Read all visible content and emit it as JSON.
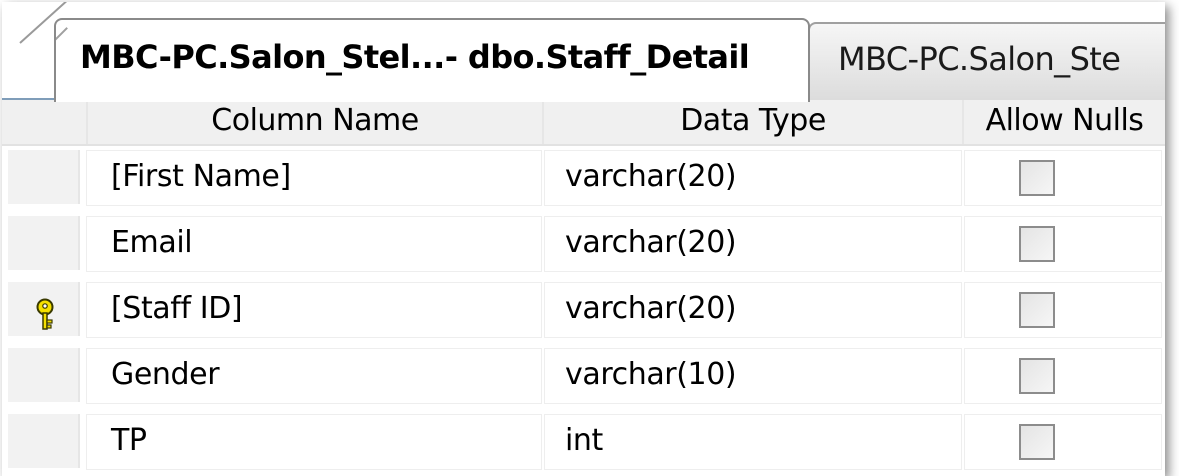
{
  "tabs": [
    {
      "label": "MBC-PC.Salon_Stel...- dbo.Staff_Detail",
      "active": true
    },
    {
      "label": "MBC-PC.Salon_Ste",
      "active": false
    }
  ],
  "columns": {
    "name": "Column Name",
    "type": "Data Type",
    "nulls": "Allow Nulls"
  },
  "rows": [
    {
      "name": "[First Name]",
      "type": "varchar(20)",
      "allow_nulls": false,
      "primary_key": false
    },
    {
      "name": "Email",
      "type": "varchar(20)",
      "allow_nulls": false,
      "primary_key": false
    },
    {
      "name": "[Staff ID]",
      "type": "varchar(20)",
      "allow_nulls": false,
      "primary_key": true,
      "icon": "key-icon"
    },
    {
      "name": "Gender",
      "type": "varchar(10)",
      "allow_nulls": false,
      "primary_key": false
    },
    {
      "name": "TP",
      "type": "int",
      "allow_nulls": false,
      "primary_key": false
    }
  ],
  "colors": {
    "header_bg": "#f0f0f0",
    "key_yellow": "#f5e000",
    "tab_border": "#8a8a8a"
  }
}
